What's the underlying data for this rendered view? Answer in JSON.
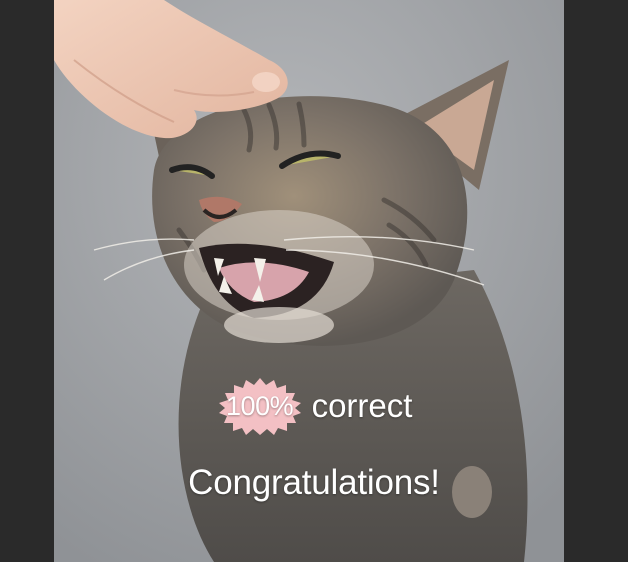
{
  "badge": {
    "text": "100%",
    "color": "#f3c0c4"
  },
  "caption": {
    "word": "correct",
    "message": "Congratulations!"
  },
  "colors": {
    "letterbox": "#2a2a2a",
    "text": "#ffffff"
  }
}
